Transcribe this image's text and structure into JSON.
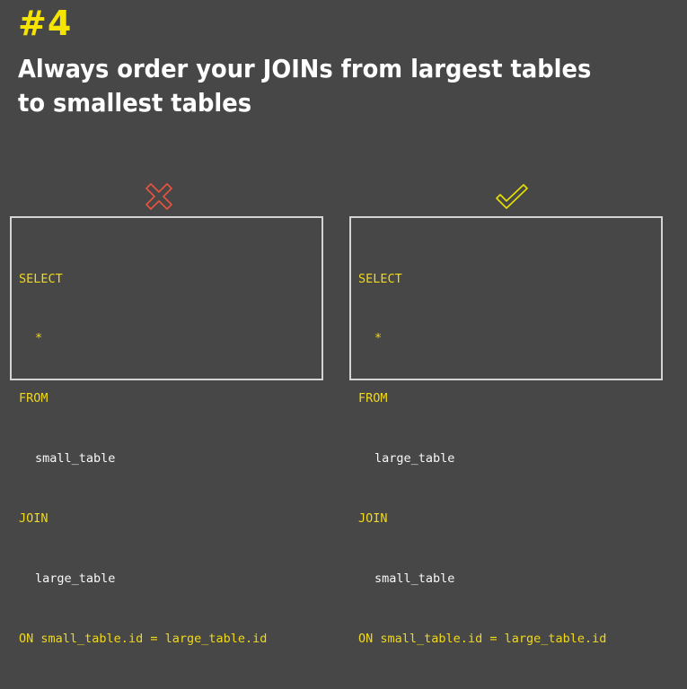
{
  "slide": {
    "number": "#4",
    "headline": "Always order your JOINs from largest tables to smallest tables"
  },
  "colors": {
    "background": "#474747",
    "accent_yellow": "#f5e400",
    "wrong_red": "#e8533f",
    "right_yellow": "#e8e000"
  },
  "icons": {
    "wrong": "cross-icon",
    "right": "check-icon"
  },
  "bad_example": {
    "select": "SELECT",
    "star": "*",
    "from": "FROM",
    "from_table": "small_table",
    "join": "JOIN",
    "join_table": "large_table",
    "on_keyword": "ON",
    "on_left": "small_table.id",
    "equals": "=",
    "on_right": "large_table.id"
  },
  "good_example": {
    "select": "SELECT",
    "star": "*",
    "from": "FROM",
    "from_table": "large_table",
    "join": "JOIN",
    "join_table": "small_table",
    "on_keyword": "ON",
    "on_left": "small_table.id",
    "equals": "=",
    "on_right": "large_table.id"
  }
}
